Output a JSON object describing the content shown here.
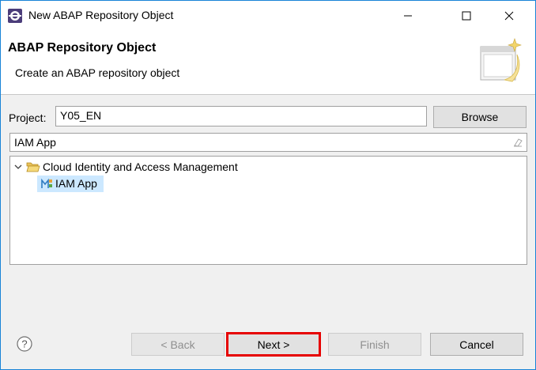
{
  "window": {
    "title": "New ABAP Repository Object",
    "accent_color": "#1883d7"
  },
  "header": {
    "title": "ABAP Repository Object",
    "description": "Create an ABAP repository object"
  },
  "form": {
    "project_label": "Project:",
    "project_value": "Y05_EN",
    "browse_label": "Browse",
    "filter_value": "IAM App"
  },
  "tree": {
    "folder": {
      "label": "Cloud Identity and Access Management",
      "icon": "folder-open-icon",
      "expanded": true
    },
    "item": {
      "label": "IAM App",
      "icon": "iam-app-icon",
      "selected": true
    }
  },
  "footer": {
    "back_label": "< Back",
    "next_label": "Next >",
    "finish_label": "Finish",
    "cancel_label": "Cancel",
    "highlight_color": "#e60000"
  }
}
